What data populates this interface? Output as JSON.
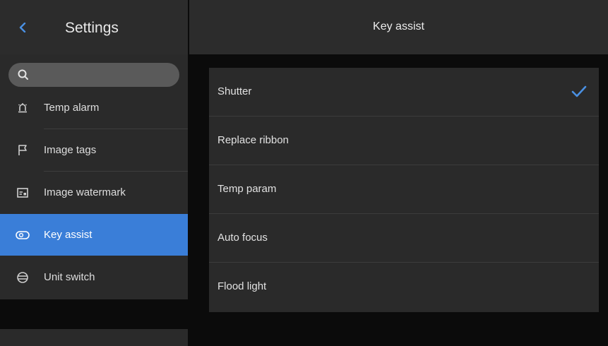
{
  "sidebar": {
    "title": "Settings",
    "back_icon": "chevron-left-icon",
    "search": {
      "placeholder": "",
      "icon": "search-icon"
    },
    "items": [
      {
        "label": "Temp alarm",
        "icon": "alarm-icon",
        "active": false
      },
      {
        "label": "Image tags",
        "icon": "flag-icon",
        "active": false
      },
      {
        "label": "Image watermark",
        "icon": "watermark-icon",
        "active": false
      },
      {
        "label": "Key assist",
        "icon": "toggle-key-icon",
        "active": true
      },
      {
        "label": "Unit switch",
        "icon": "globe-icon",
        "active": false
      }
    ]
  },
  "main": {
    "title": "Key assist",
    "options": [
      {
        "label": "Shutter",
        "selected": true
      },
      {
        "label": "Replace ribbon",
        "selected": false
      },
      {
        "label": "Temp param",
        "selected": false
      },
      {
        "label": "Auto focus",
        "selected": false
      },
      {
        "label": "Flood light",
        "selected": false
      }
    ]
  },
  "colors": {
    "accent": "#3a7ed8",
    "background": "#0b0b0b",
    "panel": "#2a2a2a",
    "header": "#2c2c2c"
  }
}
